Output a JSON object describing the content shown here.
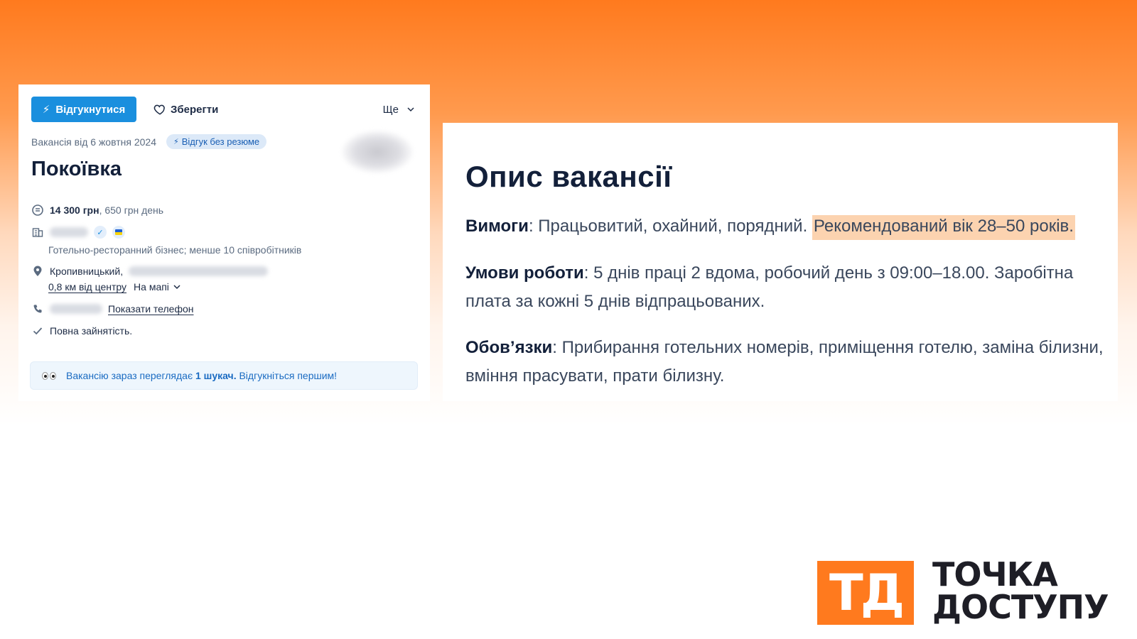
{
  "vacancy_card": {
    "respond_button": "Відгукнутися",
    "save_button": "Зберегти",
    "more_menu": "Ще",
    "posted": "Вакансія від 6 жовтня 2024",
    "no_resume_badge": "Відгук без резюме",
    "title": "Покоївка",
    "salary_main": "14 300 грн",
    "salary_sub": ", 650 грн день",
    "company_description": "Готельно-ресторанний бізнес; менше 10 співробітників",
    "city": "Кропивницький,",
    "distance_link": "0,8 км від центру",
    "map_toggle": "На мапі",
    "show_phone_link": "Показати телефон",
    "employment": "Повна зайнятість.",
    "banner_prefix": "Вакансію зараз переглядає ",
    "banner_bold": "1 шукач.",
    "banner_suffix": " Відгукніться першим!"
  },
  "description": {
    "heading": "Опис вакансії",
    "requirements_label": "Вимоги",
    "requirements_text": ": Працьовитий, охайний, порядний. ",
    "requirements_highlight": "Рекомендований вік 28–50 років.",
    "conditions_label": "Умови роботи",
    "conditions_text": ": 5 днів праці 2 вдома, робочий день з 09:00–18.00. Заробітна плата за кожні 5 днів відпрацьованих.",
    "duties_label": "Обов’язки",
    "duties_text": ": Прибирання готельних номерів, приміщення готелю, заміна білизни, вміння прасувати, прати білизну."
  },
  "logo": {
    "mark": "ТД",
    "line1": "ТОЧКА",
    "line2": "ДОСТУПУ"
  },
  "colors": {
    "accent_orange": "#ff7a1e",
    "primary_blue": "#1a8fde",
    "highlight": "#fcd3b0"
  },
  "icons": [
    "bolt-icon",
    "heart-icon",
    "chevron-down-icon",
    "coin-icon",
    "building-icon",
    "verified-icon",
    "ua-flag-icon",
    "location-pin-icon",
    "phone-icon",
    "check-icon",
    "eyes-icon"
  ]
}
